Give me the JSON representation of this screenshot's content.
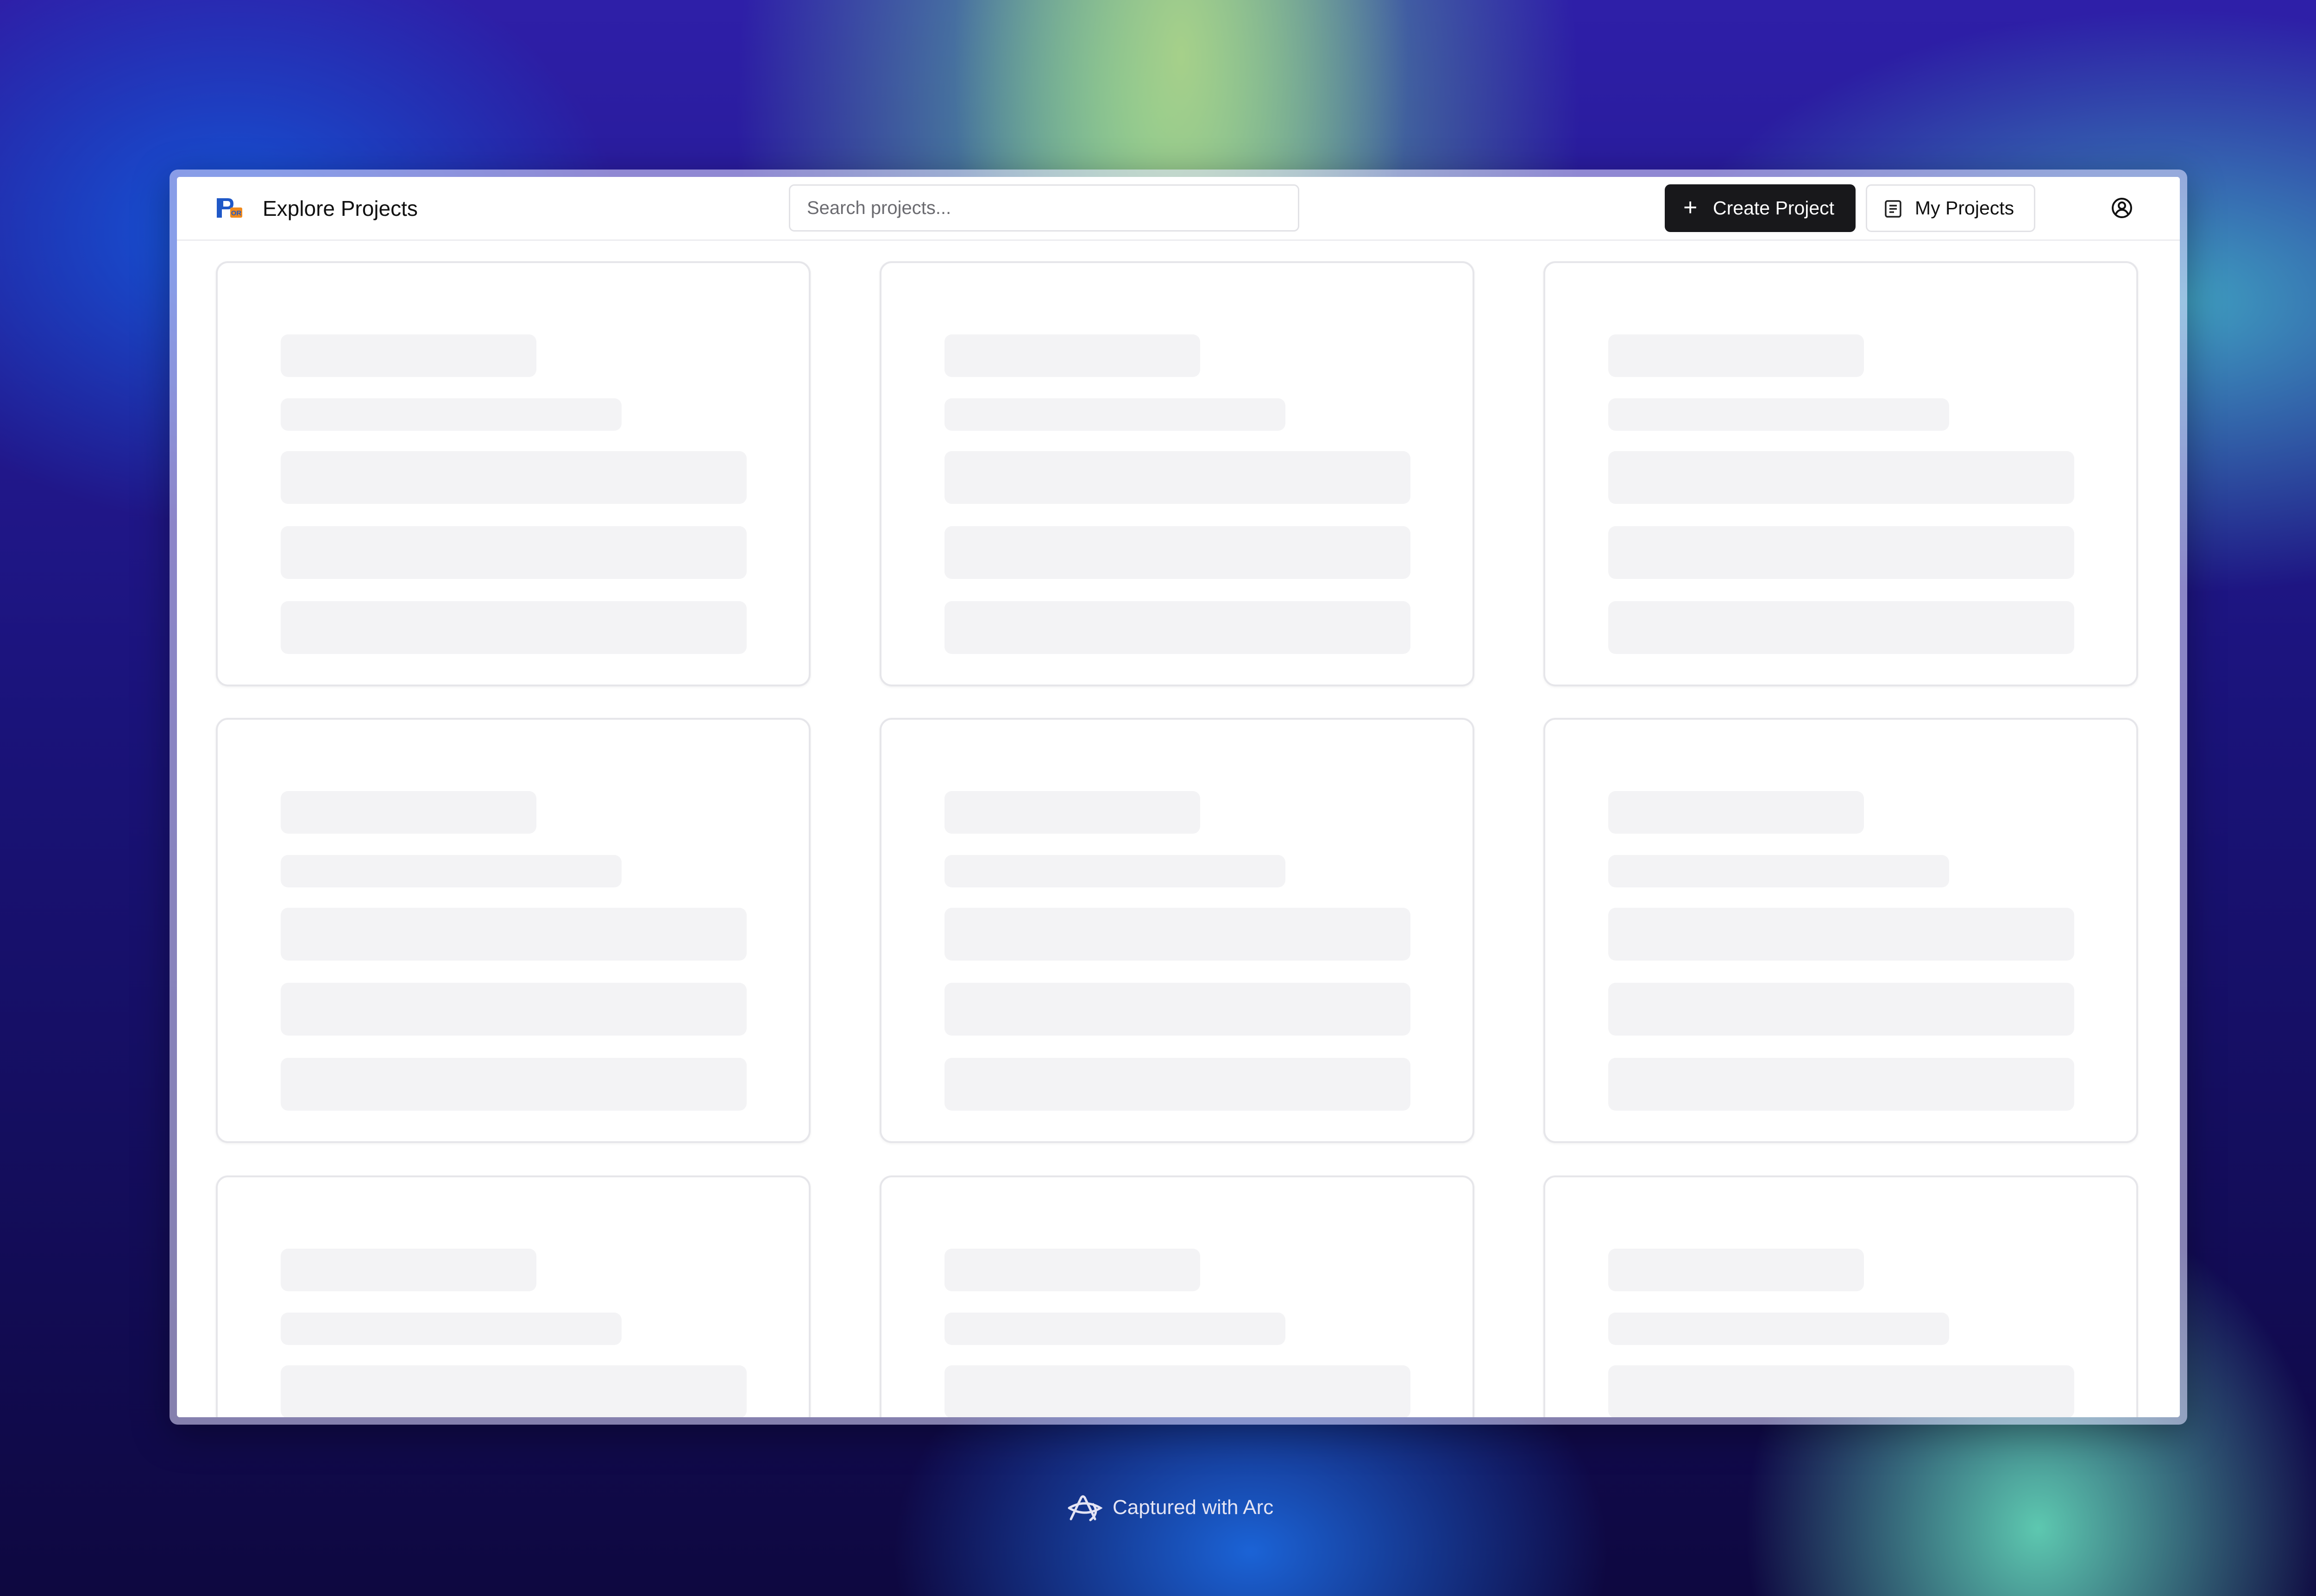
{
  "header": {
    "title": "Explore Projects",
    "search_placeholder": "Search projects...",
    "create_label": "Create Project",
    "my_projects_label": "My Projects"
  },
  "icons": {
    "logo": "app-logo",
    "create": "plus-icon",
    "my_projects": "document-list-icon",
    "user": "user-circle-icon",
    "footer": "arc-browser-icon"
  },
  "grid": {
    "state": "loading",
    "columns": 3,
    "visible_rows": 3,
    "card_count": 9
  },
  "footer": {
    "caption": "Captured with Arc"
  },
  "colors": {
    "primary_button": "#18181b",
    "skeleton": "#f3f3f5",
    "border": "#e6e6ea",
    "logo_blue": "#1f58c7",
    "logo_orange": "#f08a1c"
  }
}
